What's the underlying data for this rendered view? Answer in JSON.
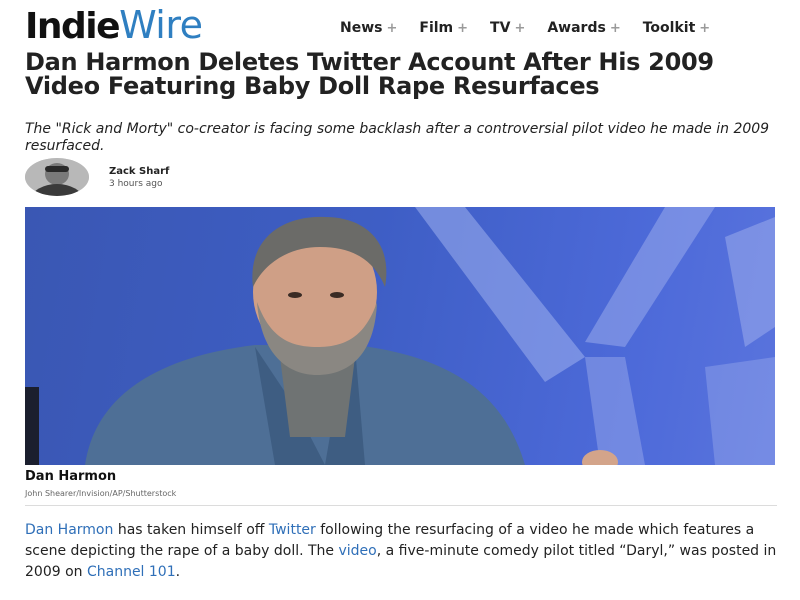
{
  "logo": {
    "part1": "Indie",
    "part2": "Wire"
  },
  "nav": [
    {
      "label": "News"
    },
    {
      "label": "Film"
    },
    {
      "label": "TV"
    },
    {
      "label": "Awards"
    },
    {
      "label": "Toolkit"
    }
  ],
  "nav_expand_glyph": "+",
  "article": {
    "headline": "Dan Harmon Deletes Twitter Account After His 2009 Video Featuring Baby Doll Rape Resurfaces",
    "dek": "The \"Rick and Morty\" co-creator is facing some backlash after a controversial pilot video he made in 2009 resurfaced.",
    "author": {
      "name": "Zack Sharf",
      "time": "3 hours ago"
    },
    "image": {
      "caption": "Dan Harmon",
      "credit": "John Shearer/Invision/AP/Shutterstock"
    },
    "body": {
      "link1": "Dan Harmon",
      "t1": " has taken himself off ",
      "link2": "Twitter",
      "t2": " following the resurfacing of a video he made which features a scene depicting the rape of a baby doll. The ",
      "link3": "video",
      "t3": ", a five-minute comedy pilot titled “Daryl,” was posted in 2009 on ",
      "link4": "Channel 101",
      "t4": "."
    }
  },
  "colors": {
    "brand_blue": "#2f7fc1",
    "link": "#2f6fb8",
    "text": "#222222"
  }
}
